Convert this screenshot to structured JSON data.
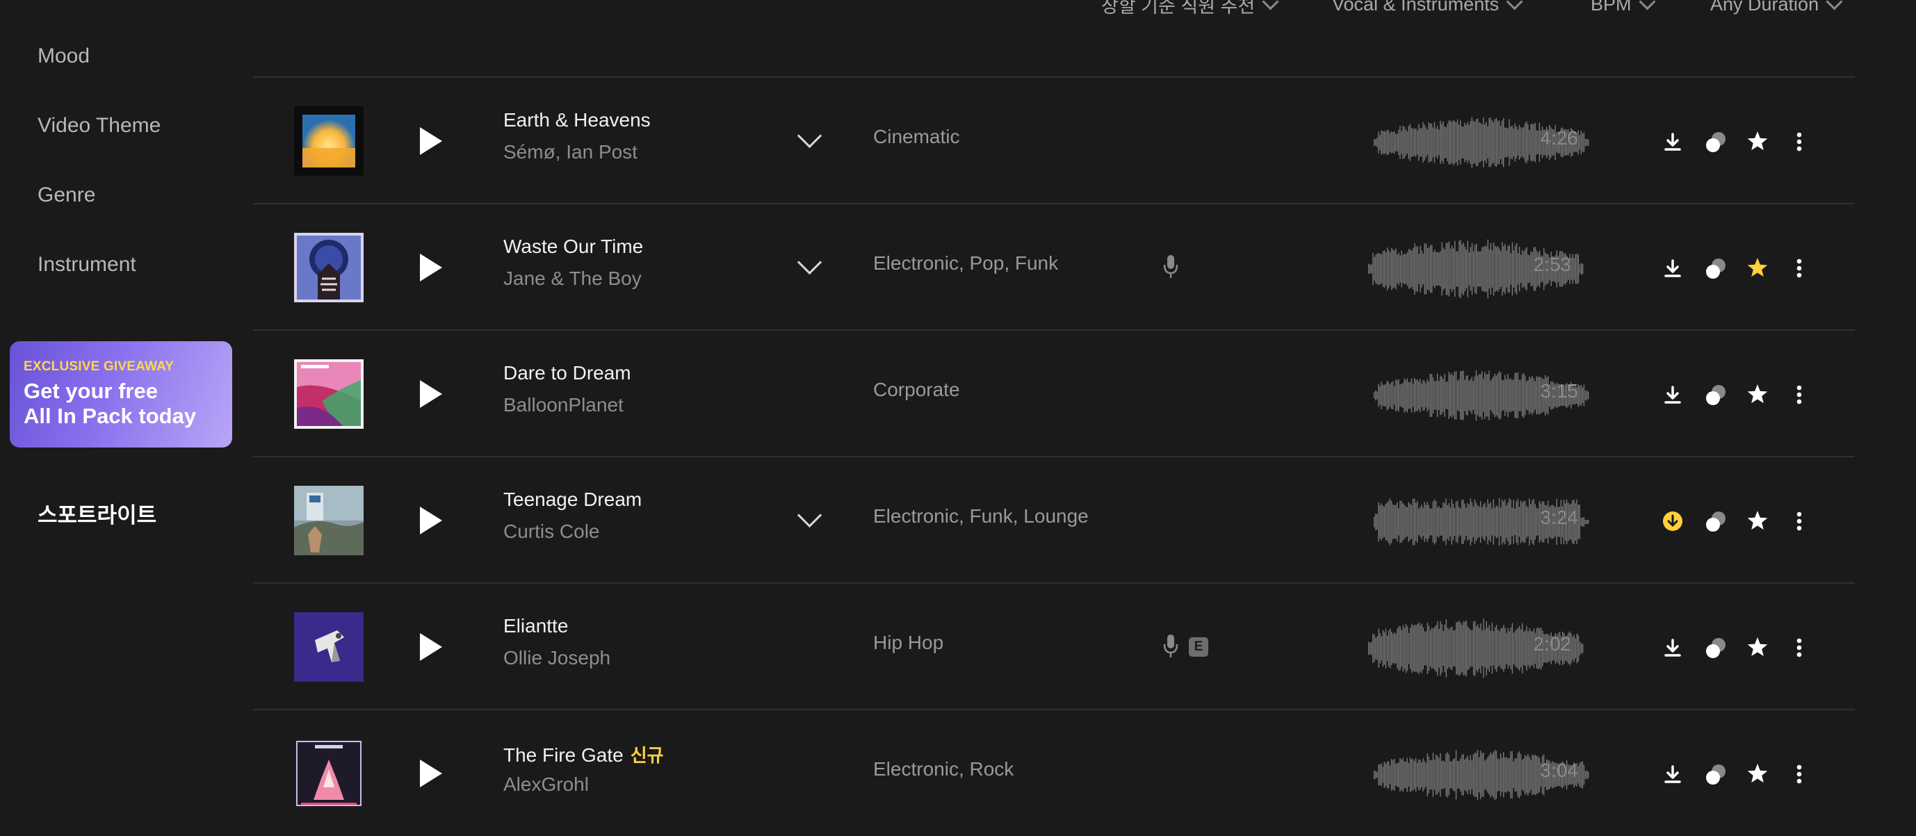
{
  "sidebar": {
    "items": [
      {
        "label": "Mood"
      },
      {
        "label": "Video Theme"
      },
      {
        "label": "Genre"
      },
      {
        "label": "Instrument"
      }
    ],
    "promo": {
      "tag": "EXCLUSIVE GIVEAWAY",
      "line1": "Get your free",
      "line2": "All In Pack today"
    },
    "spotlight": "스포트라이트"
  },
  "filters": [
    {
      "label": "장할 기준 직원 추천"
    },
    {
      "label": "Vocal & Instruments"
    },
    {
      "label": "BPM"
    },
    {
      "label": "Any Duration"
    }
  ],
  "colors": {
    "background": "#1a1a1a",
    "accent_yellow": "#ffd23c",
    "promo_purple": "#7b63e4",
    "divider": "#303030"
  },
  "tracks": [
    {
      "title": "Earth & Heavens",
      "new_badge": "",
      "artist": "Sémø, Ian Post",
      "genres": "Cinematic",
      "duration": "4:26",
      "expandable": true,
      "vocal": false,
      "explicit": false,
      "downloaded": false,
      "favorited": false
    },
    {
      "title": "Waste Our Time",
      "new_badge": "",
      "artist": "Jane & The Boy",
      "genres": "Electronic,  Pop,  Funk",
      "duration": "2:53",
      "expandable": true,
      "vocal": true,
      "explicit": false,
      "downloaded": false,
      "favorited": true
    },
    {
      "title": "Dare to Dream",
      "new_badge": "",
      "artist": "BalloonPlanet",
      "genres": "Corporate",
      "duration": "3:15",
      "expandable": false,
      "vocal": false,
      "explicit": false,
      "downloaded": false,
      "favorited": false
    },
    {
      "title": "Teenage Dream",
      "new_badge": "",
      "artist": "Curtis Cole",
      "genres": "Electronic,  Funk,  Lounge",
      "duration": "3:24",
      "expandable": true,
      "vocal": false,
      "explicit": false,
      "downloaded": true,
      "favorited": false
    },
    {
      "title": "Eliantte",
      "new_badge": "",
      "artist": "Ollie Joseph",
      "genres": "Hip Hop",
      "duration": "2:02",
      "expandable": false,
      "vocal": true,
      "explicit": true,
      "explicit_label": "E",
      "downloaded": false,
      "favorited": false
    },
    {
      "title": "The Fire Gate",
      "new_badge": "신규",
      "artist": "AlexGrohl",
      "genres": "Electronic,  Rock",
      "duration": "3:04",
      "expandable": false,
      "vocal": false,
      "explicit": false,
      "downloaded": false,
      "favorited": false
    }
  ],
  "icons": {
    "play": "play-icon",
    "download": "download-icon",
    "stems": "stems-icon",
    "favorite": "star-icon",
    "more": "more-vertical-icon",
    "microphone": "microphone-icon",
    "expand": "chevron-down-icon"
  }
}
